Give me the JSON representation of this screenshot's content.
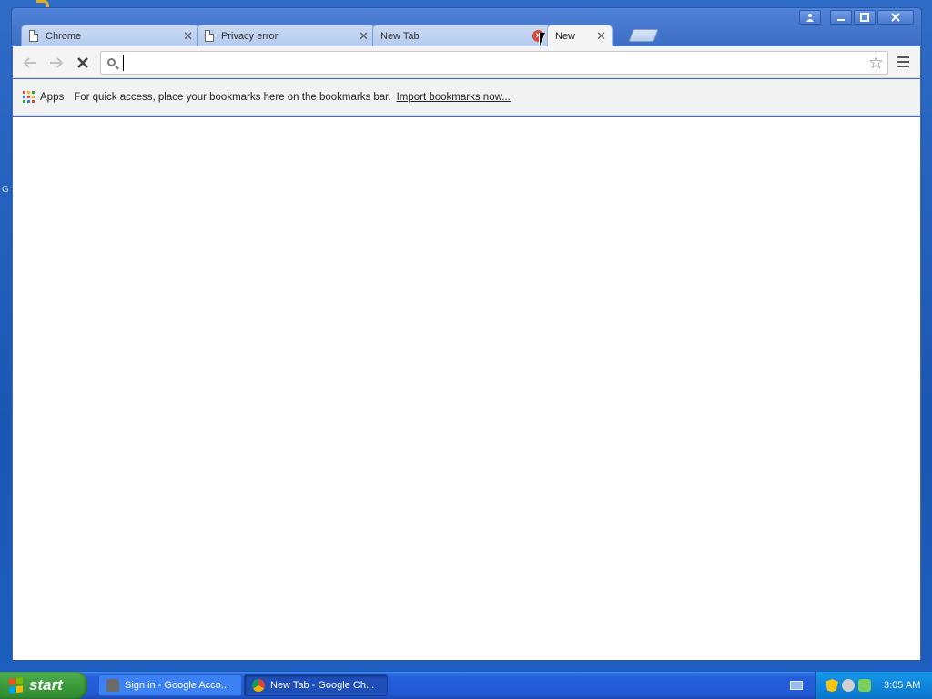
{
  "desktop": {
    "edge_letter": "G"
  },
  "browser": {
    "tabs": [
      {
        "title": "Chrome",
        "active": false
      },
      {
        "title": "Privacy error",
        "active": false
      },
      {
        "title": "New Tab",
        "active": false
      },
      {
        "title": "New",
        "active": true
      }
    ],
    "omnibox": {
      "value": "",
      "placeholder": ""
    },
    "bookmarks_bar": {
      "apps_label": "Apps",
      "hint": "For quick access, place your bookmarks here on the bookmarks bar.",
      "import_link": "Import bookmarks now..."
    }
  },
  "taskbar": {
    "start_label": "start",
    "tasks": [
      {
        "label": "Sign in - Google Acco...",
        "active": false
      },
      {
        "label": "New Tab - Google Ch...",
        "active": true
      }
    ],
    "clock": "3:05 AM"
  },
  "colors": {
    "taskbar_blue": "#245edb",
    "start_green": "#3c9a3c",
    "tray_blue": "#0f86dd",
    "tab_inactive": "#b5cbee"
  },
  "icons": {
    "nav": [
      "back-arrow-icon",
      "forward-arrow-icon",
      "stop-icon"
    ],
    "omnibox": [
      "search-icon",
      "star-icon"
    ],
    "menu": "hamburger-menu-icon"
  }
}
